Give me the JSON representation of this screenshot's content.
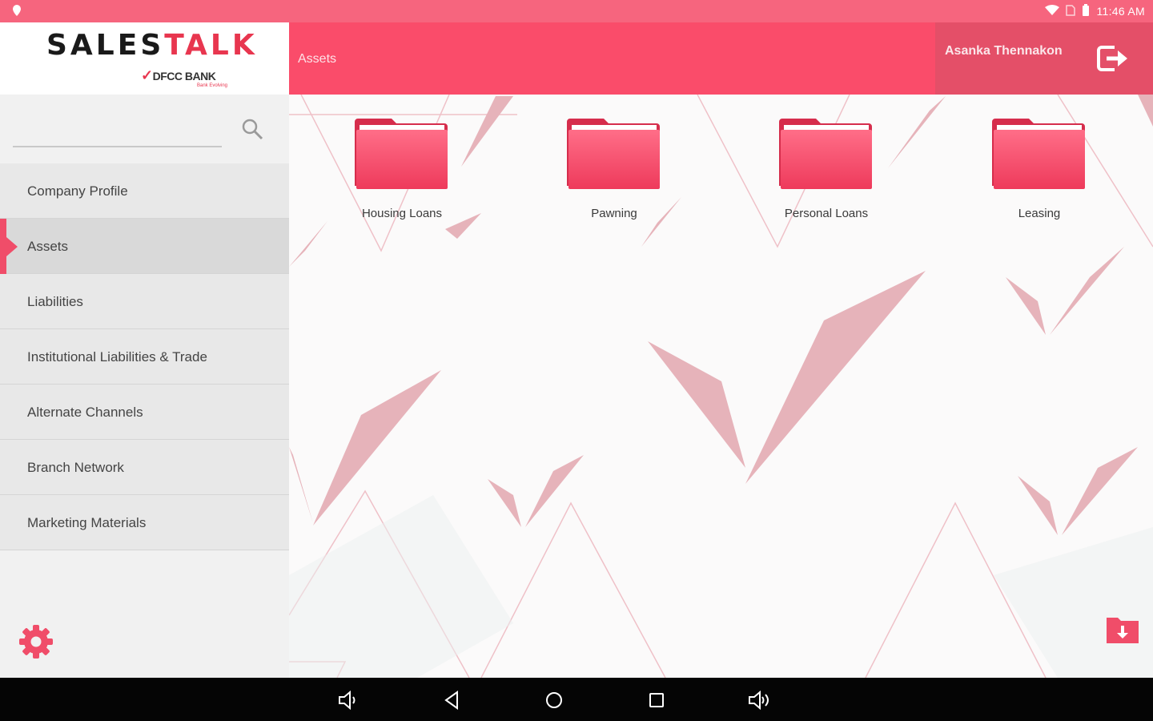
{
  "status_bar": {
    "time": "11:46 AM",
    "icons": [
      "location-icon",
      "wifi-icon",
      "sim-icon",
      "battery-icon"
    ]
  },
  "logo": {
    "title_main": "SALES",
    "title_accent": "TALK",
    "subtitle": "DFCC BANK",
    "tagline": "Bank Evolving"
  },
  "header": {
    "title": "Assets",
    "user_name": "Asanka Thennakon",
    "logout_icon": "logout-icon"
  },
  "sidebar": {
    "search": {
      "value": "",
      "placeholder": ""
    },
    "items": [
      {
        "label": "Company Profile",
        "active": false
      },
      {
        "label": "Assets",
        "active": true
      },
      {
        "label": "Liabilities",
        "active": false
      },
      {
        "label": "Institutional Liabilities & Trade",
        "active": false
      },
      {
        "label": "Alternate Channels",
        "active": false
      },
      {
        "label": "Branch Network",
        "active": false
      },
      {
        "label": "Marketing Materials",
        "active": false
      }
    ],
    "settings_icon": "gear-icon"
  },
  "main": {
    "folders": [
      {
        "label": "Housing Loans",
        "icon": "folder-icon"
      },
      {
        "label": "Pawning",
        "icon": "folder-icon"
      },
      {
        "label": "Personal Loans",
        "icon": "folder-icon"
      },
      {
        "label": "Leasing",
        "icon": "folder-icon"
      }
    ],
    "download_icon": "download-icon"
  },
  "nav_bar": {
    "icons": [
      "volume-down-icon",
      "back-icon",
      "home-icon",
      "recents-icon",
      "volume-up-icon"
    ]
  },
  "colors": {
    "brand": "#fa4c6a",
    "status_bar": "#f6657e",
    "user_panel": "#e44f68",
    "accent": "#f04d69"
  }
}
